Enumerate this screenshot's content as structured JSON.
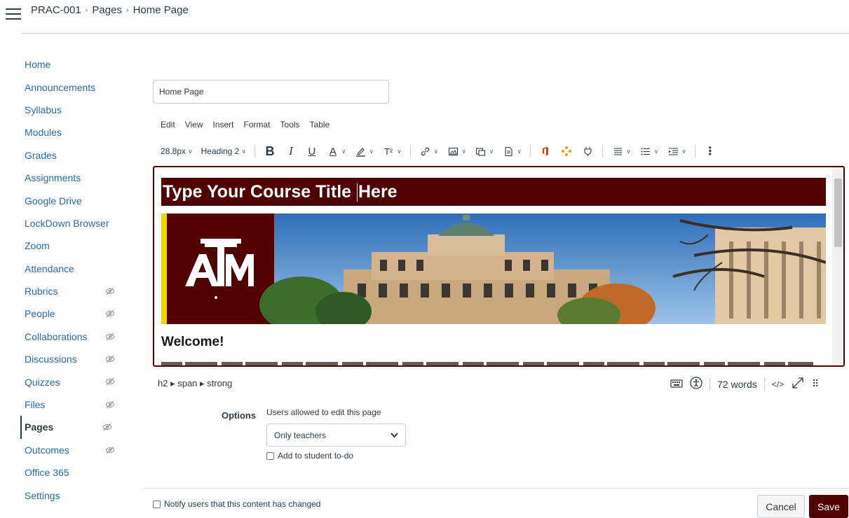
{
  "breadcrumb": {
    "course": "PRAC-001",
    "section": "Pages",
    "current": "Home Page"
  },
  "nav": {
    "items": [
      {
        "label": "Home",
        "hidden": false
      },
      {
        "label": "Announcements",
        "hidden": false
      },
      {
        "label": "Syllabus",
        "hidden": false
      },
      {
        "label": "Modules",
        "hidden": false
      },
      {
        "label": "Grades",
        "hidden": false
      },
      {
        "label": "Assignments",
        "hidden": false
      },
      {
        "label": "Google Drive",
        "hidden": false
      },
      {
        "label": "LockDown Browser",
        "hidden": false
      },
      {
        "label": "Zoom",
        "hidden": false
      },
      {
        "label": "Attendance",
        "hidden": false
      },
      {
        "label": "Rubrics",
        "hidden": true
      },
      {
        "label": "People",
        "hidden": true
      },
      {
        "label": "Collaborations",
        "hidden": true
      },
      {
        "label": "Discussions",
        "hidden": true
      },
      {
        "label": "Quizzes",
        "hidden": true
      },
      {
        "label": "Files",
        "hidden": true
      },
      {
        "label": "Pages",
        "hidden": true,
        "active": true
      },
      {
        "label": "Outcomes",
        "hidden": true
      },
      {
        "label": "Office 365",
        "hidden": false
      },
      {
        "label": "Settings",
        "hidden": false
      }
    ]
  },
  "page": {
    "title_value": "Home Page"
  },
  "editor": {
    "menu": [
      "Edit",
      "View",
      "Insert",
      "Format",
      "Tools",
      "Table"
    ],
    "toolbar": {
      "font_size": "28.8px",
      "block_format": "Heading 2"
    },
    "content": {
      "heading_before_caret": "Type Your Course Title ",
      "heading_after_caret": "Here",
      "welcome": "Welcome!"
    },
    "status": {
      "path": "h2 ▸ span ▸ strong",
      "word_count": "72 words",
      "html_toggle": "</>"
    }
  },
  "options": {
    "label": "Options",
    "edit_desc": "Users allowed to edit this page",
    "edit_selected": "Only teachers",
    "todo_label": "Add to student to-do"
  },
  "footer": {
    "notify_label": "Notify users that this content has changed",
    "cancel_label": "Cancel",
    "save_label": "Save"
  },
  "colors": {
    "maroon": "#500000",
    "link": "#2b6a9d",
    "text": "#2d3b45"
  }
}
